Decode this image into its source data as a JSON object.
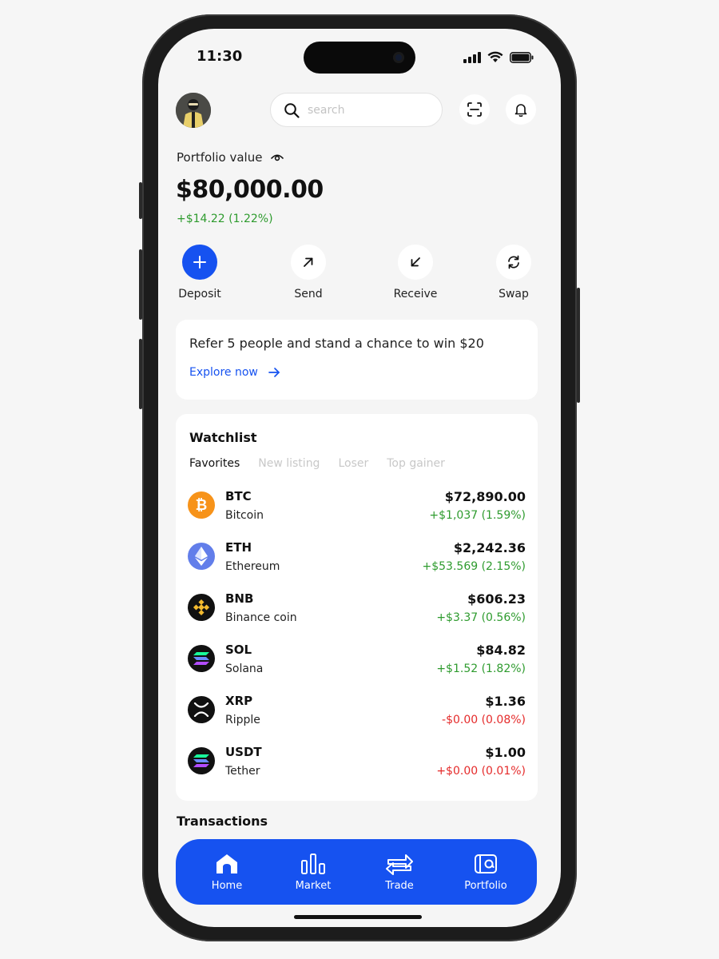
{
  "status_bar": {
    "time": "11:30"
  },
  "header": {
    "search_placeholder": "search"
  },
  "portfolio": {
    "label": "Portfolio value",
    "value": "$80,000.00",
    "change": "+$14.22 (1.22%)"
  },
  "actions": [
    {
      "label": "Deposit",
      "icon": "plus-icon"
    },
    {
      "label": "Send",
      "icon": "arrow-up-right-icon"
    },
    {
      "label": "Receive",
      "icon": "arrow-down-left-icon"
    },
    {
      "label": "Swap",
      "icon": "swap-icon"
    }
  ],
  "referral": {
    "text": "Refer 5 people and stand a chance to win $20",
    "link": "Explore now"
  },
  "watchlist": {
    "title": "Watchlist",
    "tabs": [
      "Favorites",
      "New listing",
      "Loser",
      "Top gainer"
    ],
    "active_tab": "Favorites",
    "items": [
      {
        "symbol": "BTC",
        "name": "Bitcoin",
        "price": "$72,890.00",
        "change": "+$1,037 (1.59%)",
        "direction": "up"
      },
      {
        "symbol": "ETH",
        "name": "Ethereum",
        "price": "$2,242.36",
        "change": "+$53.569 (2.15%)",
        "direction": "up"
      },
      {
        "symbol": "BNB",
        "name": "Binance coin",
        "price": "$606.23",
        "change": "+$3.37 (0.56%)",
        "direction": "up"
      },
      {
        "symbol": "SOL",
        "name": "Solana",
        "price": "$84.82",
        "change": "+$1.52 (1.82%)",
        "direction": "up"
      },
      {
        "symbol": "XRP",
        "name": "Ripple",
        "price": "$1.36",
        "change": "-$0.00 (0.08%)",
        "direction": "down"
      },
      {
        "symbol": "USDT",
        "name": "Tether",
        "price": "$1.00",
        "change": "+$0.00 (0.01%)",
        "direction": "down"
      }
    ]
  },
  "transactions": {
    "title": "Transactions"
  },
  "tabbar": [
    {
      "label": "Home",
      "icon": "home-icon"
    },
    {
      "label": "Market",
      "icon": "market-icon"
    },
    {
      "label": "Trade",
      "icon": "trade-icon"
    },
    {
      "label": "Portfolio",
      "icon": "portfolio-icon"
    }
  ],
  "colors": {
    "accent": "#1652f0",
    "positive": "#2e9b2e",
    "negative": "#e52b2b",
    "btc": "#f7931a",
    "eth": "#627eea"
  }
}
